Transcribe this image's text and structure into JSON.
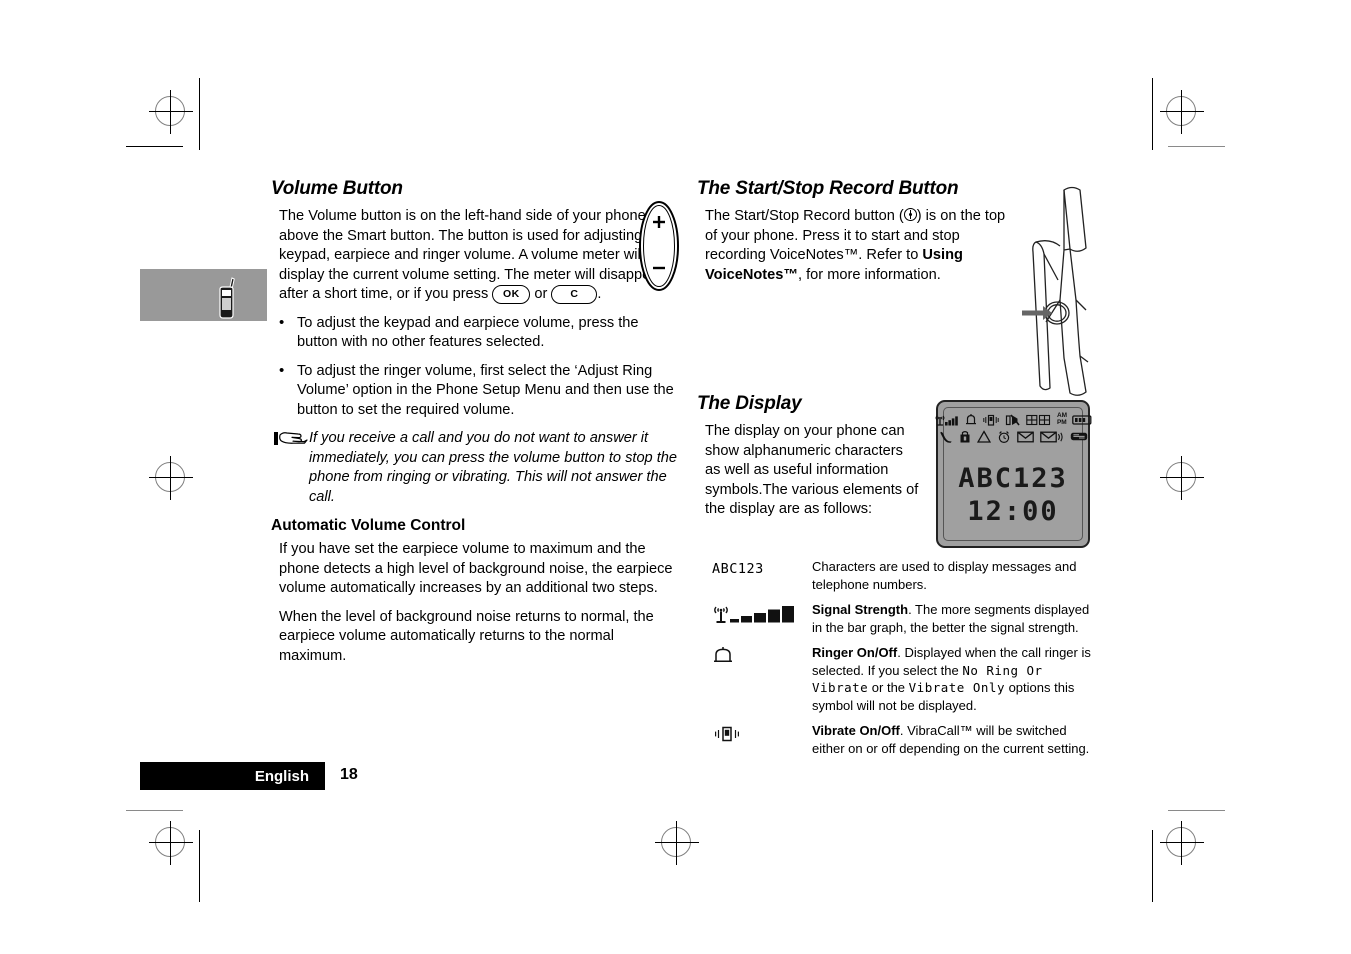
{
  "document": {
    "language_footer": "English",
    "page_number": "18"
  },
  "left_column": {
    "heading": "Volume Button",
    "intro_part1": "The Volume button is on the left-hand side of your phone, above the Smart button. The button is used for adjusting the keypad, earpiece and ringer volume. A volume meter will display the current volume setting. The meter will disappear after a short time, or if you press ",
    "key_ok": "OK",
    "key_or": " or ",
    "key_c": "C",
    "intro_end": ".",
    "bullets": [
      "To adjust the keypad and earpiece volume, press the button with no other features selected.",
      "To adjust the ringer volume, first select the ‘Adjust Ring Volume’ option in the Phone Setup Menu and then use the button to set the required volume."
    ],
    "note": "If you receive a call and you do not want to answer it immediately, you can press the volume button to stop the phone from ringing or vibrating. This will not answer the call.",
    "subheading": "Automatic Volume Control",
    "avc_para1": "If you have set the earpiece volume to maximum and the phone detects a high level of background noise, the earpiece volume automatically increases by an additional two steps.",
    "avc_para2": "When the level of background noise returns to normal, the earpiece volume automatically returns to the normal maximum.",
    "volume_button_plus": "+",
    "volume_button_minus": "–"
  },
  "right_column": {
    "record_heading": "The Start/Stop Record Button",
    "record_text_a": "The Start/Stop Record button (",
    "record_text_b": ") is on the top of your phone. Press it to start and stop recording VoiceNotes™. Refer to ",
    "record_bold_ref": "Using VoiceNotes™",
    "record_text_c": ", for more information.",
    "display_heading": "The Display",
    "display_text": "The display on your phone can show alphanumeric characters as well as useful information symbols.The various elements of the display are as follows:"
  },
  "lcd": {
    "line1": "ABC123",
    "line2": "12:00",
    "status_icons_row1": [
      "antenna-signal-icon",
      "bell-ringer-icon",
      "vibrate-icon",
      "ringer-off-icon",
      "menu-grid-icon",
      "am-pm-icon",
      "battery-icon"
    ],
    "status_icons_row2": [
      "phone-handset-icon",
      "lock-icon",
      "triangle-icon",
      "alarm-clock-icon",
      "envelope-icon",
      "envelope-sound-icon",
      "voicemail-icon"
    ],
    "am_label": "AM",
    "pm_label": "PM"
  },
  "symbols": [
    {
      "icon": "abc123-characters-icon",
      "icon_text": "ABC123",
      "desc_bold": "",
      "desc": "Characters are used to display messages and telephone numbers."
    },
    {
      "icon": "signal-strength-icon",
      "desc_bold": "Signal Strength",
      "desc": ". The more segments displayed in the bar graph, the better the signal strength."
    },
    {
      "icon": "ringer-bell-icon",
      "desc_bold": "Ringer On/Off",
      "desc": ". Displayed when the call ringer is selected. If you select the ",
      "desc_lcd1": "No Ring Or Vibrate",
      "desc_mid": " or the ",
      "desc_lcd2": "Vibrate Only",
      "desc_tail": " options this symbol will not be displayed."
    },
    {
      "icon": "vibrate-on-off-icon",
      "desc_bold": "Vibrate On/Off",
      "desc": ". VibraCall™ will be switched either on or off depending on the current setting."
    }
  ],
  "signal_bars": [
    4,
    7,
    10,
    13,
    16
  ],
  "colors": {
    "tab_marker": "#999999",
    "lcd_background": "#a0a0a0",
    "footer_bar": "#000000"
  }
}
